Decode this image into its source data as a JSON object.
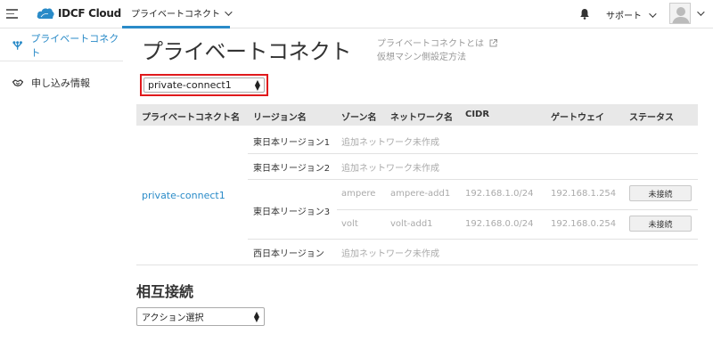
{
  "header": {
    "logo_text": "IDCF Cloud",
    "nav_tab": "プライベートコネクト",
    "support": "サポート"
  },
  "sidebar": {
    "items": [
      {
        "label": "プライベートコネクト",
        "icon": "network-icon",
        "active": true
      },
      {
        "label": "申し込み情報",
        "icon": "handshake-icon",
        "active": false
      }
    ]
  },
  "main": {
    "title": "プライベートコネクト",
    "help_link_1": "プライベートコネクトとは",
    "help_link_2": "仮想マシン側設定方法",
    "connect_select": "private-connect1",
    "table": {
      "headers": [
        "プライベートコネクト名",
        "リージョン名",
        "ゾーン名",
        "ネットワーク名",
        "CIDR",
        "ゲートウェイ",
        "ステータス"
      ],
      "connect_name": "private-connect1",
      "regions": {
        "r1": "東日本リージョン1",
        "r2": "東日本リージョン2",
        "r3": "東日本リージョン3",
        "r4": "西日本リージョン"
      },
      "not_created": "追加ネットワーク未作成",
      "rows": [
        {
          "zone": "ampere",
          "network": "ampere-add1",
          "cidr": "192.168.1.0/24",
          "gateway": "192.168.1.254",
          "status": "未接続"
        },
        {
          "zone": "volt",
          "network": "volt-add1",
          "cidr": "192.168.0.0/24",
          "gateway": "192.168.0.254",
          "status": "未接続"
        }
      ]
    },
    "section_title": "相互接続",
    "action_select": "アクション選択"
  },
  "colors": {
    "accent": "#2a8bc8",
    "highlight_border": "#e0191c",
    "muted_text": "#aaaaaa"
  }
}
